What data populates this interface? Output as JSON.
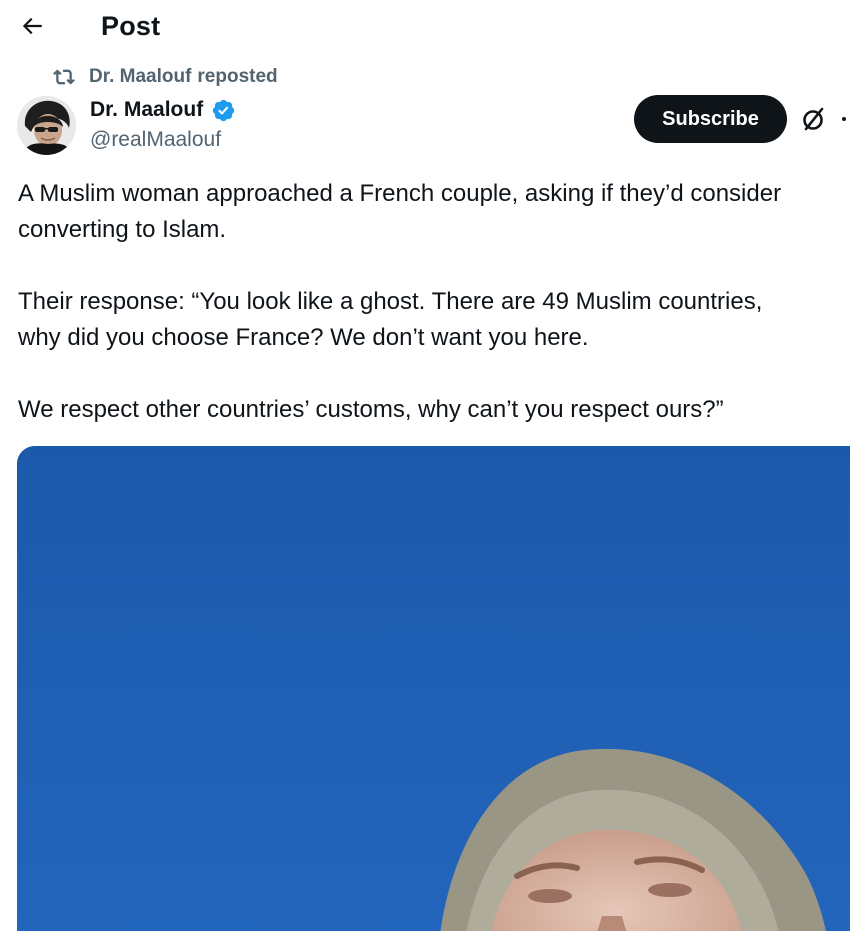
{
  "header": {
    "title": "Post",
    "back_icon": "arrow-left-icon"
  },
  "repost": {
    "icon": "repost-icon",
    "reposter": "Dr. Maalouf",
    "action": "reposted"
  },
  "author": {
    "name": "Dr. Maalouf",
    "handle": "@realMaalouf",
    "verified": true,
    "verified_color": "#1d9bf0"
  },
  "actions": {
    "subscribe_label": "Subscribe",
    "grok_icon": "grok-icon",
    "more_icon": "more-icon"
  },
  "tweet": {
    "lines": [
      "A Muslim woman approached a French couple, asking if they’d consider",
      "converting to Islam.",
      "",
      "Their response: “You look like a ghost. There are 49 Muslim countries,",
      "why did you choose France? We don’t want you here.",
      "",
      "We respect other countries’ customs, why can’t you respect ours?”"
    ]
  },
  "media": {
    "type": "video-still",
    "sky_color": "#1d5fb3"
  },
  "colors": {
    "text_primary": "#0f1419",
    "text_secondary": "#536471",
    "button_dark": "#0f1419"
  }
}
